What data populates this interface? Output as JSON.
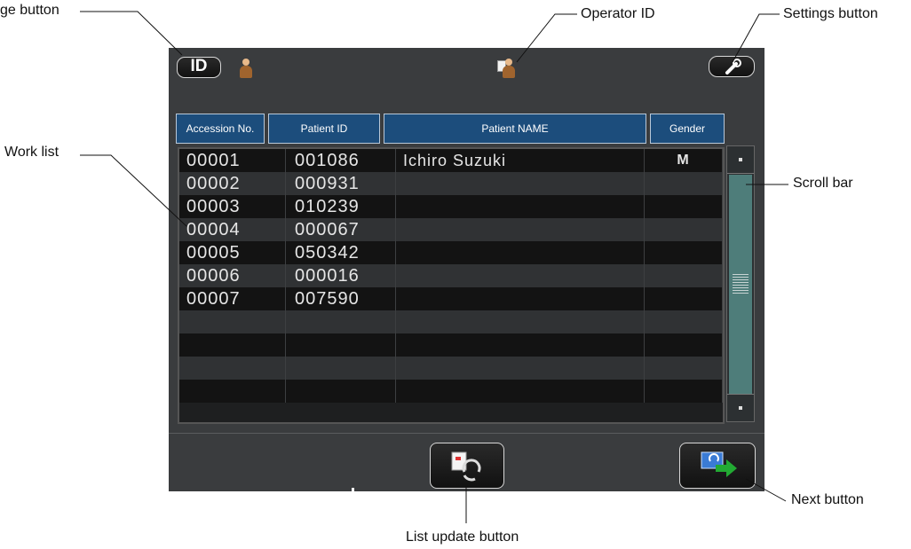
{
  "callouts": {
    "id_change_button": "ge button",
    "operator_id": "Operator ID",
    "settings_button": "Settings button",
    "work_list": "Work list",
    "scroll_bar": "Scroll bar",
    "next_button": "Next button",
    "list_update_button": "List update button"
  },
  "header": {
    "id_button_label": "ID"
  },
  "table": {
    "columns": [
      "Accession No.",
      "Patient ID",
      "Patient NAME",
      "Gender"
    ],
    "rows": [
      [
        "00001",
        "001086",
        "Ichiro Suzuki",
        "M"
      ],
      [
        "00002",
        "000931",
        "",
        ""
      ],
      [
        "00003",
        "010239",
        "",
        ""
      ],
      [
        "00004",
        "000067",
        "",
        ""
      ],
      [
        "00005",
        "050342",
        "",
        ""
      ],
      [
        "00006",
        "000016",
        "",
        ""
      ],
      [
        "00007",
        "007590",
        "",
        ""
      ],
      [
        "",
        "",
        "",
        ""
      ],
      [
        "",
        "",
        "",
        ""
      ],
      [
        "",
        "",
        "",
        ""
      ],
      [
        "",
        "",
        "",
        ""
      ]
    ]
  },
  "icons": {
    "id_button": "id-card-icon",
    "user": "user-icon",
    "operator": "operator-id-icon",
    "settings": "wrench-icon",
    "list_update": "list-refresh-icon",
    "next": "next-arrow-icon"
  },
  "colors": {
    "screen_bg": "#3a3c3e",
    "header_blue": "#1c4d7c",
    "scroll_thumb": "#4e7d7a",
    "next_arrow": "#22aa33"
  }
}
